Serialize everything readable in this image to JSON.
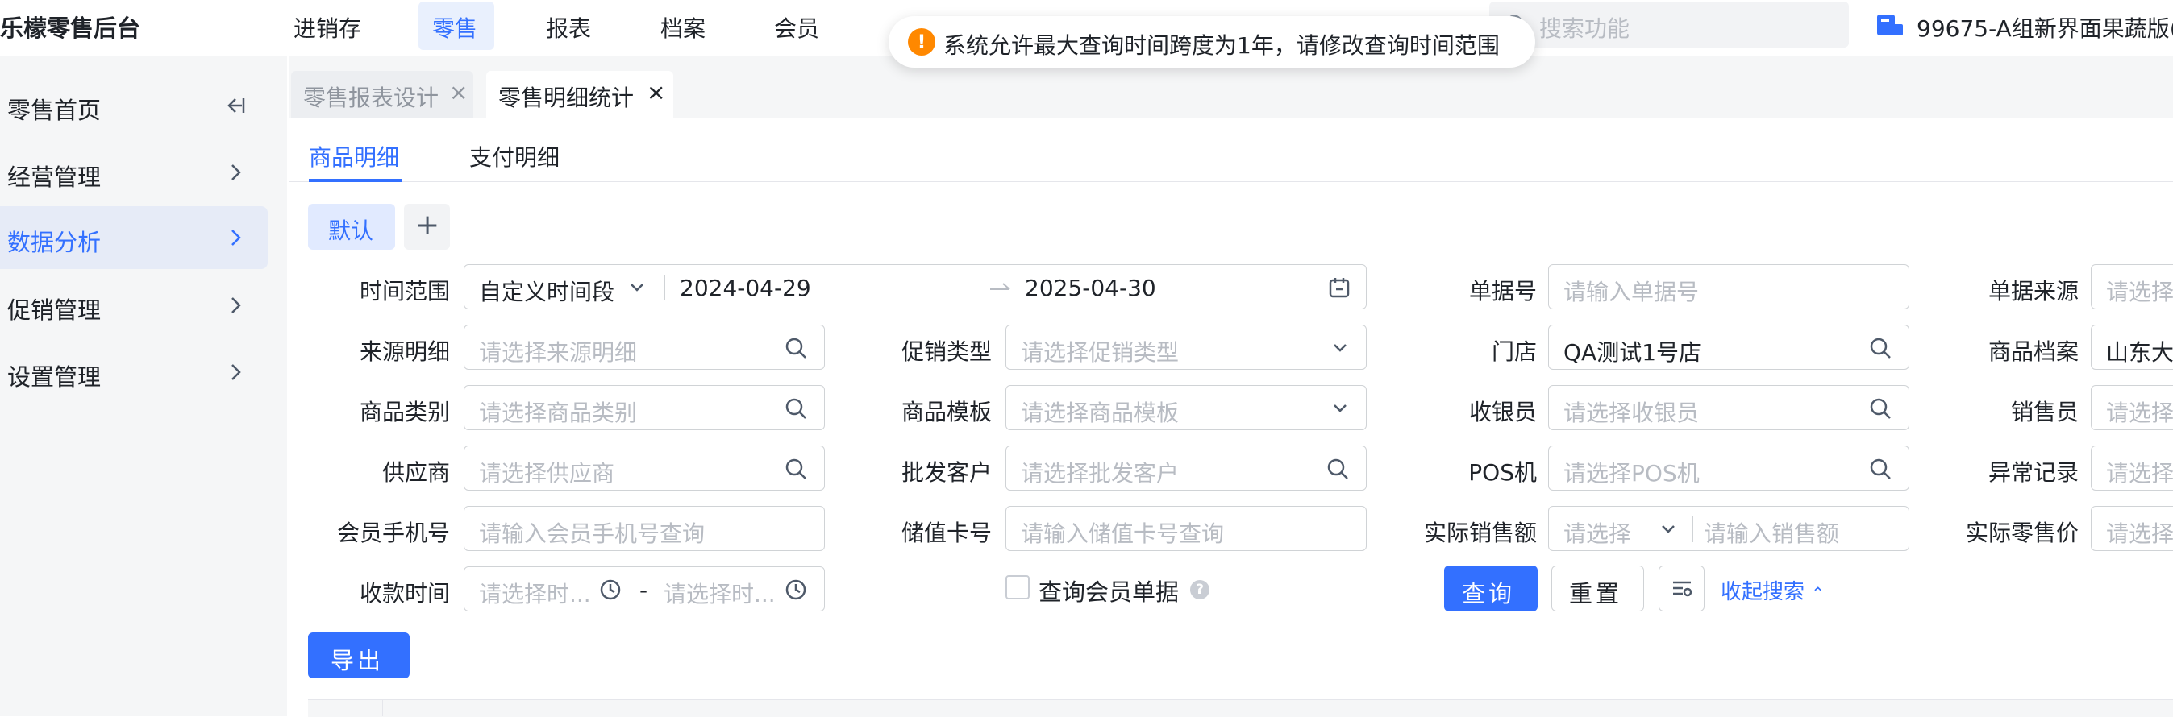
{
  "header": {
    "logo": "乐檬零售后台",
    "nav": [
      "进销存",
      "零售",
      "报表",
      "档案",
      "会员"
    ],
    "active_nav": "零售",
    "search_placeholder": "搜索功能",
    "store": "99675-A组新界面果蔬版("
  },
  "toast": {
    "message": "系统允许最大查询时间跨度为1年，请修改查询时间范围"
  },
  "sidebar": {
    "items": [
      {
        "label": "零售首页",
        "icon": "collapse-icon"
      },
      {
        "label": "经营管理",
        "icon": "chevron-right-icon"
      },
      {
        "label": "数据分析",
        "icon": "chevron-right-icon",
        "active": true
      },
      {
        "label": "促销管理",
        "icon": "chevron-right-icon"
      },
      {
        "label": "设置管理",
        "icon": "chevron-right-icon"
      }
    ]
  },
  "page_tabs": [
    {
      "label": "零售报表设计",
      "active": false
    },
    {
      "label": "零售明细统计",
      "active": true
    }
  ],
  "sub_tabs": [
    "商品明细",
    "支付明细"
  ],
  "filter_tabs": {
    "default": "默认",
    "add": "+"
  },
  "form": {
    "time_range": {
      "label": "时间范围",
      "mode": "自定义时间段",
      "start": "2024-04-29",
      "end": "2025-04-30"
    },
    "bill_no": {
      "label": "单据号",
      "placeholder": "请输入单据号"
    },
    "bill_source": {
      "label": "单据来源",
      "placeholder": "请选择"
    },
    "source_detail": {
      "label": "来源明细",
      "placeholder": "请选择来源明细"
    },
    "promo_type": {
      "label": "促销类型",
      "placeholder": "请选择促销类型"
    },
    "store": {
      "label": "门店",
      "value": "QA测试1号店"
    },
    "goods_archive": {
      "label": "商品档案",
      "value": "山东大"
    },
    "goods_category": {
      "label": "商品类别",
      "placeholder": "请选择商品类别"
    },
    "goods_template": {
      "label": "商品模板",
      "placeholder": "请选择商品模板"
    },
    "cashier": {
      "label": "收银员",
      "placeholder": "请选择收银员"
    },
    "salesperson": {
      "label": "销售员",
      "placeholder": "请选择"
    },
    "supplier": {
      "label": "供应商",
      "placeholder": "请选择供应商"
    },
    "wholesale_customer": {
      "label": "批发客户",
      "placeholder": "请选择批发客户"
    },
    "pos": {
      "label": "POS机",
      "placeholder": "请选择POS机"
    },
    "abnormal": {
      "label": "异常记录",
      "placeholder": "请选择"
    },
    "member_phone": {
      "label": "会员手机号",
      "placeholder": "请输入会员手机号查询"
    },
    "stored_card": {
      "label": "储值卡号",
      "placeholder": "请输入储值卡号查询"
    },
    "actual_sales": {
      "label": "实际销售额",
      "op_placeholder": "请选择",
      "placeholder": "请输入销售额"
    },
    "actual_price": {
      "label": "实际零售价",
      "placeholder": "请选择"
    },
    "pay_time": {
      "label": "收款时间",
      "start_placeholder": "请选择时...",
      "sep": "-",
      "end_placeholder": "请选择时..."
    },
    "member_only": {
      "label": "查询会员单据",
      "help": "?"
    }
  },
  "buttons": {
    "query": "查询",
    "reset": "重置",
    "collapse": "收起搜索",
    "export": "导出"
  }
}
